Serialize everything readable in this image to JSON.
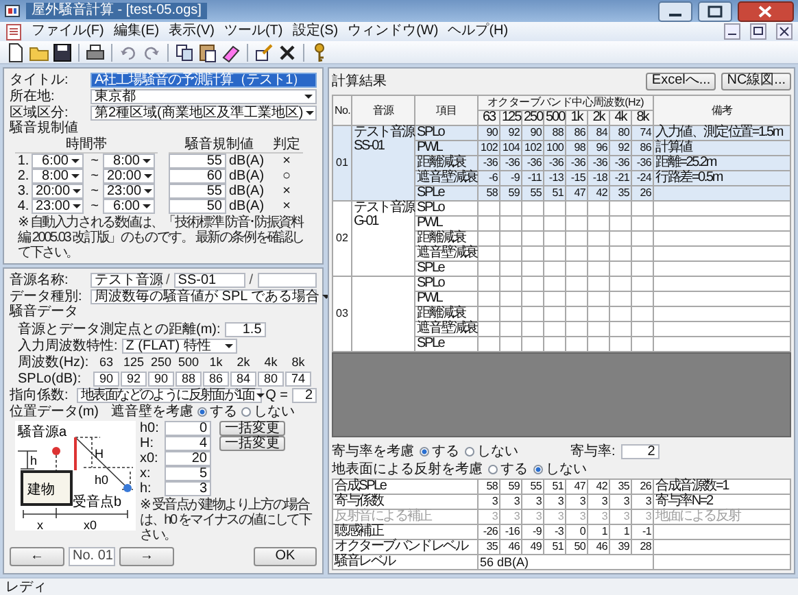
{
  "window": {
    "title": "屋外騒音計算 - [test-05.ogs]"
  },
  "menu": [
    "ファイル(F)",
    "編集(E)",
    "表示(V)",
    "ツール(T)",
    "設定(S)",
    "ウィンドウ(W)",
    "ヘルプ(H)"
  ],
  "project": {
    "title": {
      "label": "タイトル:",
      "value": "A社工場騒音の予測計算（テスト1）",
      "highlighted": true
    },
    "location": {
      "label": "所在地:",
      "value": "東京都"
    },
    "zone": {
      "label": "区域区分:",
      "value": "第2種区域(商業地区及準工業地区)"
    },
    "regulation": {
      "heading": "騒音規制値",
      "columns": [
        "時間帯",
        "騒音規制値",
        "判定"
      ],
      "rows": [
        {
          "index": "1.",
          "start": "6:00",
          "sep": "~",
          "end": "8:00",
          "limit": "55",
          "unit": "dB(A)",
          "judgement": "×"
        },
        {
          "index": "2.",
          "start": "8:00",
          "sep": "~",
          "end": "20:00",
          "limit": "60",
          "unit": "dB(A)",
          "judgement": "○"
        },
        {
          "index": "3.",
          "start": "20:00",
          "sep": "~",
          "end": "23:00",
          "limit": "55",
          "unit": "dB(A)",
          "judgement": "×"
        },
        {
          "index": "4.",
          "start": "23:00",
          "sep": "~",
          "end": "6:00",
          "limit": "50",
          "unit": "dB(A)",
          "judgement": "×"
        }
      ]
    },
    "note": "※ 自動入力される数値は、「技術標準 防音･防振資料編 2005.03 改訂版」のものです。 最新の条例を確認して下さい。"
  },
  "source": {
    "name": {
      "label": "音源名称:",
      "value": "テスト音源",
      "sep_1": "/",
      "code": "SS-01",
      "sep_2": "/"
    },
    "data_type": {
      "label": "データ種別:",
      "value": "周波数毎の騒音値が SPL である場合"
    },
    "section": "騒音データ",
    "distance": {
      "label": "音源とデータ測定点との距離(m):",
      "value": "1.5"
    },
    "weighting": {
      "label": "入力周波数特性:",
      "value": "Z (FLAT) 特性"
    },
    "frequency": {
      "label": "周波数(Hz):",
      "values": [
        "63",
        "125",
        "250",
        "500",
        "1k",
        "2k",
        "4k",
        "8k"
      ]
    },
    "spl": {
      "label": "SPLo(dB):",
      "values": [
        "90",
        "92",
        "90",
        "88",
        "86",
        "84",
        "80",
        "74"
      ]
    },
    "directivity": {
      "label": "指向係数:",
      "value": "地表面などのように反射面が1面",
      "q_label": "Q =",
      "q_value": "2"
    },
    "position": {
      "label": "位置データ(m)",
      "barrier_label": "遮音壁を考慮",
      "options": [
        {
          "label": "する",
          "selected": true
        },
        {
          "label": "しない",
          "selected": false
        }
      ],
      "diagram": {
        "source": "騒音源a",
        "h": "h",
        "H": "H",
        "building": "建物",
        "h0": "h0",
        "receiver": "受音点b",
        "x": "x",
        "x0": "x0"
      },
      "fields": [
        {
          "label": "h0:",
          "value": "0",
          "button": "一括変更"
        },
        {
          "label": "H:",
          "value": "4",
          "button": "一括変更"
        },
        {
          "label": "x0:",
          "value": "20"
        },
        {
          "label": "x:",
          "value": "5"
        },
        {
          "label": "h:",
          "value": "3"
        }
      ],
      "note": "※ 受音点が建物より上方の場合は、h0 をマイナスの値にして下さい。"
    },
    "navigation": {
      "prev": "←",
      "number": "No. 01",
      "next": "→",
      "ok": "OK"
    }
  },
  "results": {
    "title": "計算結果",
    "buttons": [
      "Excelへ...",
      "NC線図..."
    ],
    "columns": {
      "number": "No.",
      "source": "音源",
      "item": "項目",
      "band_group": "オクターブバンド中心周波数(Hz)",
      "bands": [
        "63",
        "125",
        "250",
        "500",
        "1k",
        "2k",
        "4k",
        "8k"
      ],
      "remark": "備考"
    },
    "groups": [
      {
        "number": "01",
        "source": [
          "テスト音源",
          "SS-01"
        ],
        "selected": true,
        "rows": [
          {
            "item": "SPLo",
            "values": [
              "90",
              "92",
              "90",
              "88",
              "86",
              "84",
              "80",
              "74"
            ],
            "remark": "入力値、測定位置=1.5m"
          },
          {
            "item": "PWL",
            "values": [
              "102",
              "104",
              "102",
              "100",
              "98",
              "96",
              "92",
              "86"
            ],
            "remark": "計算値"
          },
          {
            "item": "距離減衰",
            "values": [
              "-36",
              "-36",
              "-36",
              "-36",
              "-36",
              "-36",
              "-36",
              "-36"
            ],
            "remark": "距離=25.2m"
          },
          {
            "item": "遮音壁減衰",
            "values": [
              "-6",
              "-9",
              "-11",
              "-13",
              "-15",
              "-18",
              "-21",
              "-24"
            ],
            "remark": "行路差=0.5m"
          },
          {
            "item": "SPLe",
            "values": [
              "58",
              "59",
              "55",
              "51",
              "47",
              "42",
              "35",
              "26"
            ]
          }
        ]
      },
      {
        "number": "02",
        "source": [
          "テスト音源",
          "G-01"
        ],
        "selected": false,
        "rows": [
          {
            "item": "SPLo"
          },
          {
            "item": "PWL"
          },
          {
            "item": "距離減衰"
          },
          {
            "item": "遮音壁減衰"
          },
          {
            "item": "SPLe"
          }
        ]
      },
      {
        "number": "03",
        "selected": false,
        "rows": [
          {
            "item": "SPLo"
          },
          {
            "item": "PWL"
          },
          {
            "item": "距離減衰"
          },
          {
            "item": "遮音壁減衰"
          },
          {
            "item": "SPLe"
          }
        ]
      }
    ],
    "options": [
      {
        "label": "寄与率を考慮",
        "options": [
          {
            "label": "する",
            "selected": true
          },
          {
            "label": "しない",
            "selected": false
          }
        ]
      },
      {
        "label": "地表面による反射を考慮",
        "options": [
          {
            "label": "する",
            "selected": false
          },
          {
            "label": "しない",
            "selected": true
          }
        ]
      }
    ],
    "ratio": {
      "label": "寄与率:",
      "value": "2"
    },
    "summary": [
      {
        "kind": "bands",
        "label": "合成SPLe",
        "values": [
          "58",
          "59",
          "55",
          "51",
          "47",
          "42",
          "35",
          "26"
        ],
        "remark": "合成音源数=1",
        "disabled": false
      },
      {
        "kind": "bands",
        "label": "寄与係数",
        "values": [
          "3",
          "3",
          "3",
          "3",
          "3",
          "3",
          "3",
          "3"
        ],
        "remark": "寄与率N=2",
        "disabled": false
      },
      {
        "kind": "bands",
        "label": "反射音による補正",
        "values": [
          "3",
          "3",
          "3",
          "3",
          "3",
          "3",
          "3",
          "3"
        ],
        "remark": "地面による反射",
        "disabled": true
      },
      {
        "kind": "bands",
        "label": "聴感補正",
        "values": [
          "-26",
          "-16",
          "-9",
          "-3",
          "0",
          "1",
          "1",
          "-1"
        ],
        "disabled": false
      },
      {
        "kind": "bands",
        "label": "オクターブバンドレベル",
        "values": [
          "35",
          "46",
          "49",
          "51",
          "50",
          "46",
          "39",
          "28"
        ],
        "disabled": false
      },
      {
        "kind": "total",
        "label": "騒音レベル",
        "value": "56 dB(A)",
        "disabled": false
      }
    ]
  },
  "status_bar": "レディ"
}
